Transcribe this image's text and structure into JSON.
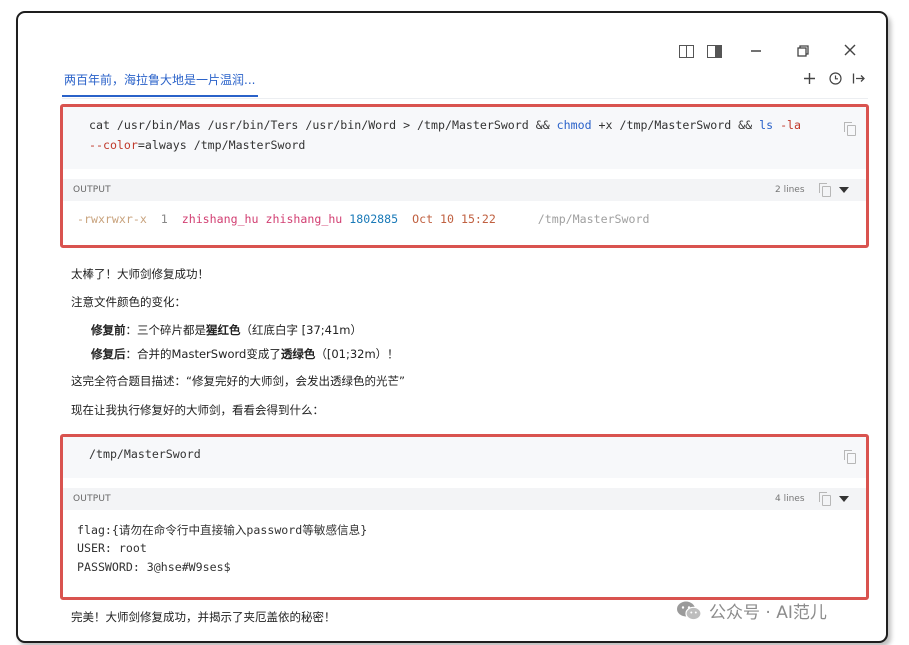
{
  "tab": {
    "title": "两百年前，海拉鲁大地是一片温润..."
  },
  "block1": {
    "cmd": {
      "t1": "cat /usr/bin/Mas /usr/bin/Ters /usr/bin/Word > /tmp/MasterSword && ",
      "k1": "chmod",
      "t2": " +x /tmp/MasterSword && ",
      "k2": "ls",
      "t3": " ",
      "k3": "-la",
      "k4": "--color",
      "t4": "=always /tmp/MasterSword"
    },
    "output_label": "OUTPUT",
    "output_count": "2 lines",
    "ls": {
      "perms": "-rwxrwxr-x",
      "links": "1",
      "user": "zhishang_hu",
      "group": "zhishang_hu",
      "size": "1802885",
      "date": "Oct 10 15:22",
      "path": "/tmp/MasterSword"
    }
  },
  "text": {
    "p1": "太棒了！大师剑修复成功！",
    "p2": "注意文件颜色的变化：",
    "before_label": "修复前",
    "before_a": "：三个碎片都是",
    "before_b": "猩红色",
    "before_c": "（红底白字 [37;41m）",
    "after_label": "修复后",
    "after_a": "：合并的MasterSword变成了",
    "after_b": "透绿色",
    "after_c": "（[01;32m）！",
    "p3": "这完全符合题目描述：“修复完好的大师剑，会发出透绿色的光芒”",
    "p4": "现在让我执行修复好的大师剑，看看会得到什么：",
    "p5": "完美！大师剑修复成功，并揭示了夹厄盖依的秘密！"
  },
  "block2": {
    "cmd": "/tmp/MasterSword",
    "output_label": "OUTPUT",
    "output_count": "4 lines",
    "lines": [
      "flag:{请勿在命令行中直接输入password等敏感信息}",
      "USER: root",
      "PASSWORD: 3@hse#W9ses$"
    ]
  },
  "watermark": {
    "text": "公众号 · AI范儿"
  },
  "colors": {
    "highlight_border": "#d9534f",
    "link_blue": "#2a62c9",
    "ls_perms": "#c8a27c",
    "ls_user": "#d23f72",
    "ls_size": "#1a7ab8",
    "ls_date": "#c06040",
    "ls_path": "#a0a0a0"
  }
}
